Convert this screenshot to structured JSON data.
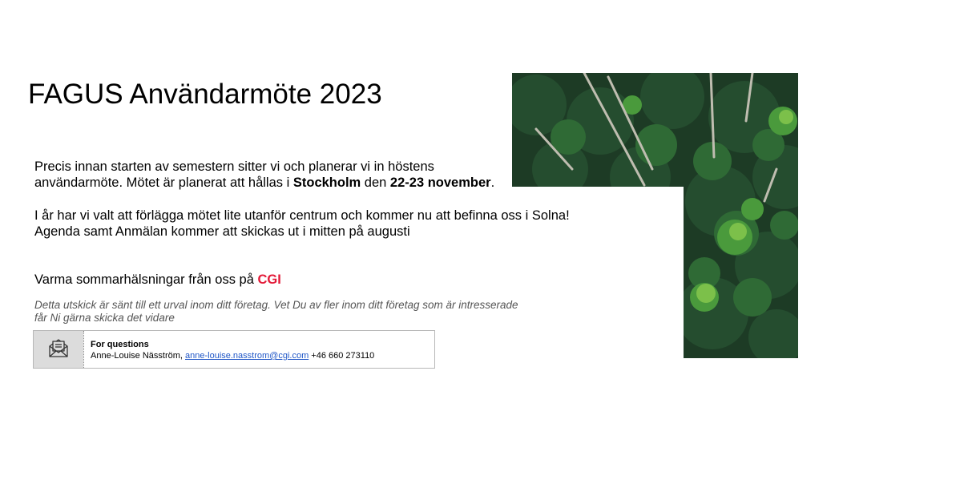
{
  "title": "FAGUS Användarmöte 2023",
  "intro": {
    "part1": "Precis innan starten av semestern sitter vi och planerar vi in höstens",
    "part2": "användarmöte. Mötet är planerat att hållas i ",
    "location": "Stockholm",
    "part3": " den ",
    "dates": "22-23 november",
    "part4": "."
  },
  "info": {
    "line1": "I år har vi valt att förlägga mötet lite utanför centrum och kommer nu att befinna oss i Solna!",
    "line2": "Agenda samt Anmälan kommer att skickas ut i mitten på augusti"
  },
  "greeting": {
    "text": "Varma sommarhälsningar från oss på ",
    "brand": "CGI"
  },
  "disclaimer": {
    "line1": "Detta utskick är sänt till ett urval inom ditt företag. Vet Du av fler inom ditt företag som är intresserade",
    "line2": "får Ni gärna skicka det vidare"
  },
  "contact": {
    "heading": "For questions",
    "name": "Anne-Louise Näsström, ",
    "email": "anne-louise.nasstrom@cgi.com",
    "phone": " +46 660 273110",
    "icon": "envelope-letter-icon"
  },
  "colors": {
    "accent": "#e31937",
    "link": "#1f56c7",
    "forest": "#1f4a2a"
  }
}
